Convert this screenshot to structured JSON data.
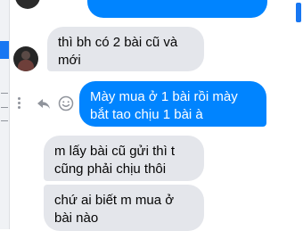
{
  "conversation": {
    "messages": [
      {
        "direction": "incoming",
        "text": "thì bh có 2 bài cũ và\nmới"
      },
      {
        "direction": "outgoing",
        "text": "Mày mua ở 1 bài rồi mày\nbắt tao chịu 1 bài à"
      },
      {
        "direction": "incoming",
        "text": "m lấy bài cũ gửi thì t\ncũng phải chịu thôi"
      },
      {
        "direction": "incoming",
        "text": "chứ ai biết m mua ở\nbài nào"
      }
    ]
  },
  "message_actions": [
    "more-icon",
    "reply-icon",
    "react-icon"
  ],
  "colors": {
    "outgoing_bubble": "#0084ff",
    "incoming_bubble": "#e4e6eb",
    "incoming_text": "#050505",
    "outgoing_text": "#ffffff",
    "icon_gray": "#90949c"
  }
}
